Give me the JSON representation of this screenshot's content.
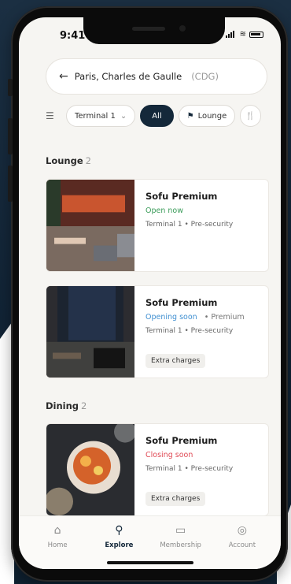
{
  "status_bar": {
    "time": "9:41"
  },
  "search": {
    "back_icon": "arrow-left-icon",
    "location": "Paris, Charles de Gaulle",
    "code": "(CDG)"
  },
  "filters": [
    {
      "label": "Terminal 1",
      "icon": "chevron-down-icon"
    },
    {
      "label": "All",
      "active": true
    },
    {
      "label": "Lounge",
      "icon": "lounge-icon"
    }
  ],
  "sections": {
    "lounge": {
      "title": "Lounge",
      "count": "2"
    },
    "dining": {
      "title": "Dining",
      "count": "2"
    }
  },
  "cards": [
    {
      "name": "Sofu Premium",
      "status": "Open now",
      "status_color": "#3b9c5a",
      "extra": "",
      "meta": "Terminal 1 • Pre-security",
      "tag": ""
    },
    {
      "name": "Sofu Premium",
      "status": "Opening soon",
      "status_color": "#3f8fd1",
      "extra": "• Premium",
      "meta": "Terminal 1 • Pre-security",
      "tag": "Extra charges"
    },
    {
      "name": "Sofu Premium",
      "status": "Closing soon",
      "status_color": "#e04a55",
      "extra": "",
      "meta": "Terminal 1 • Pre-security",
      "tag": "Extra charges"
    }
  ],
  "tabbar": [
    {
      "label": "Home",
      "icon": "home-icon",
      "active": false
    },
    {
      "label": "Explore",
      "icon": "search-icon",
      "active": true
    },
    {
      "label": "Membership",
      "icon": "card-icon",
      "active": false
    },
    {
      "label": "Account",
      "icon": "user-icon",
      "active": false
    }
  ],
  "colors": {
    "navy": "#14283a",
    "open": "#3b9c5a",
    "soon": "#3f8fd1",
    "closing": "#e04a55"
  }
}
